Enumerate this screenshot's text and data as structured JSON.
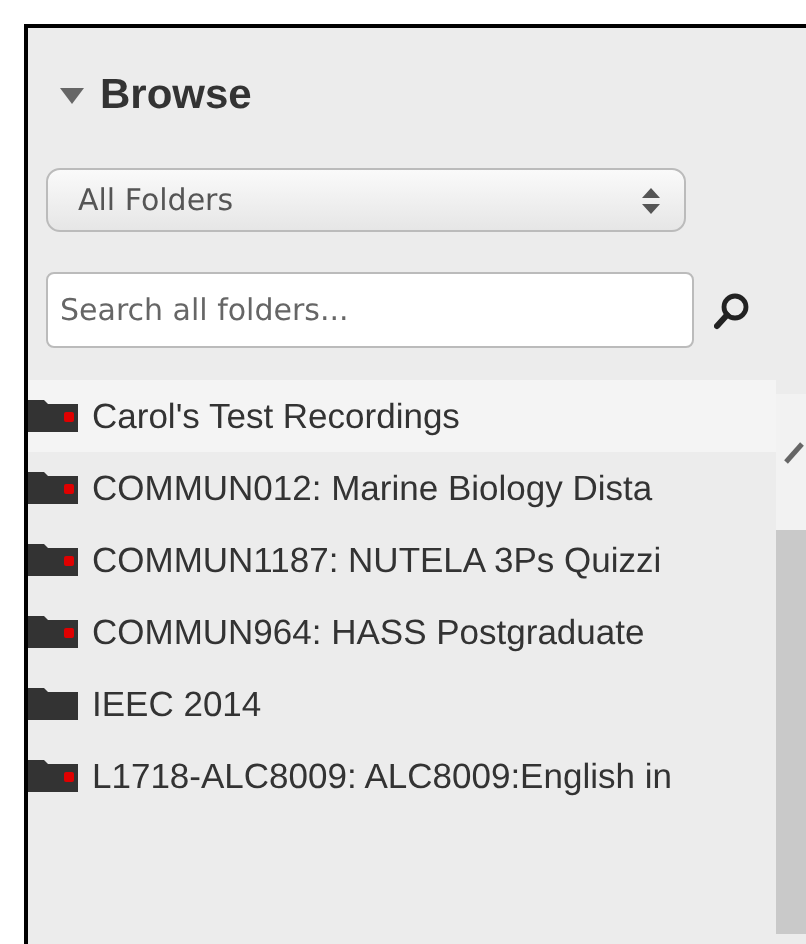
{
  "header": {
    "title": "Browse",
    "expanded": true
  },
  "folder_select": {
    "value": "All Folders"
  },
  "search": {
    "placeholder": "Search all folders..."
  },
  "folders": [
    {
      "name": "Carol's Test Recordings",
      "flagged": true
    },
    {
      "name": "COMMUN012: Marine Biology Dista",
      "flagged": true
    },
    {
      "name": "COMMUN1187: NUTELA 3Ps Quizzi",
      "flagged": true
    },
    {
      "name": "COMMUN964: HASS Postgraduate",
      "flagged": true
    },
    {
      "name": "IEEC 2014",
      "flagged": false
    },
    {
      "name": "L1718-ALC8009: ALC8009:English in",
      "flagged": true
    }
  ]
}
